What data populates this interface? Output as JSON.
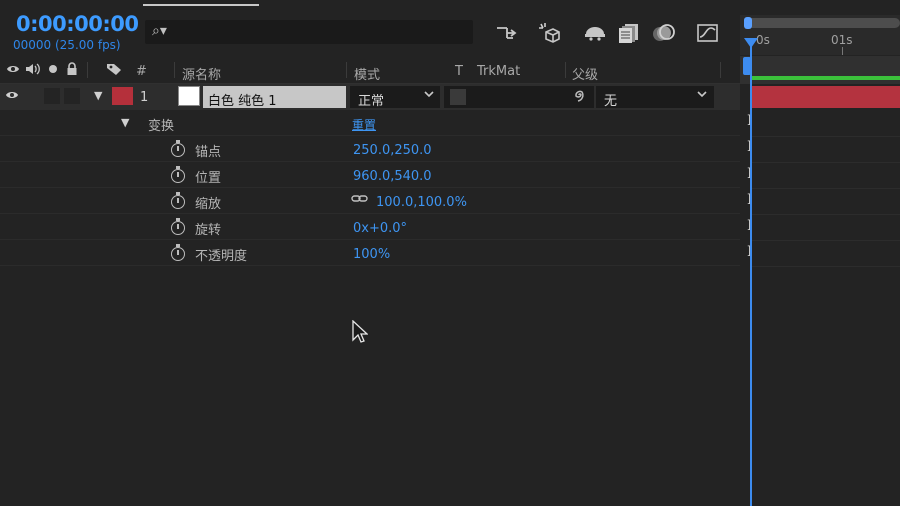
{
  "comp": {
    "timecode": "0:00:00:00",
    "frames_fps": "00000 (25.00 fps)",
    "search_placeholder": "",
    "search_glyph": "⌕▾"
  },
  "toolbar_icons": [
    "comp-flowchart-icon",
    "draft-3d-icon",
    "shy-layers-icon",
    "frame-blending-icon",
    "motion-blur-icon",
    "graph-editor-icon"
  ],
  "timeline": {
    "ruler_labels": [
      "0s",
      "01s"
    ]
  },
  "columns": {
    "hash": "#",
    "source_name": "源名称",
    "mode": "模式",
    "t": "T",
    "trkmat": "TrkMat",
    "parent": "父级"
  },
  "layer": {
    "number": "1",
    "name": "白色 纯色 1",
    "mode": "正常",
    "parent": "无",
    "label_color": "#b5303b"
  },
  "transform": {
    "label": "变换",
    "reset": "重置",
    "properties": [
      {
        "name": "锚点",
        "value": "250.0,250.0"
      },
      {
        "name": "位置",
        "value": "960.0,540.0"
      },
      {
        "name": "缩放",
        "value": "100.0,100.0%"
      },
      {
        "name": "旋转",
        "value": "0x+0.0°"
      },
      {
        "name": "不透明度",
        "value": "100%"
      }
    ]
  },
  "colors": {
    "accent_blue": "#3e95f2",
    "label_red": "#b5303b",
    "work_area_green": "#3bc13b"
  }
}
